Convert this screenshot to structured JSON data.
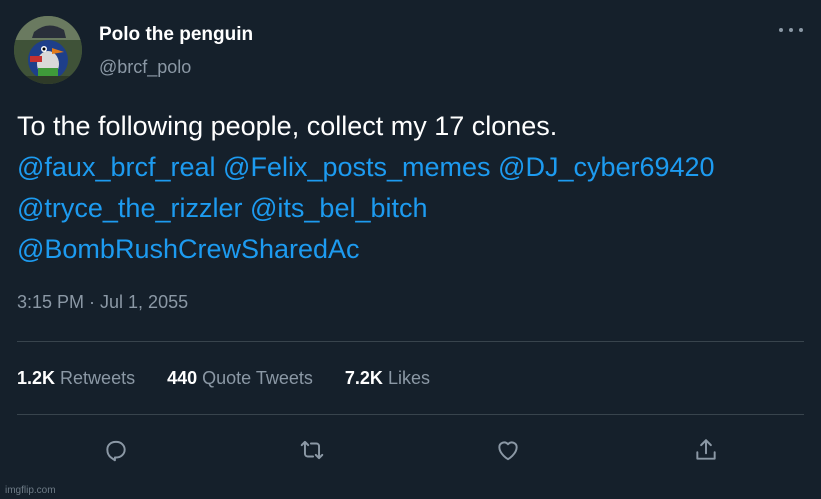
{
  "user": {
    "display_name": "Polo the penguin",
    "handle": "@brcf_polo",
    "avatar_icon": "penguin-avatar"
  },
  "tweet": {
    "text": "To the following people, collect my 17 clones.",
    "mentions": [
      "@faux_brcf_real",
      "@Felix_posts_memes",
      "@DJ_cyber69420",
      "@tryce_the_rizzler",
      "@its_bel_bitch",
      "@BombRushCrewSharedAc"
    ],
    "timestamp": "3:15 PM · Jul 1, 2055"
  },
  "stats": {
    "retweets": {
      "count": "1.2K",
      "label": "Retweets"
    },
    "quote_tweets": {
      "count": "440",
      "label": "Quote Tweets"
    },
    "likes": {
      "count": "7.2K",
      "label": "Likes"
    }
  },
  "actions": [
    {
      "icon": "reply-icon"
    },
    {
      "icon": "retweet-icon"
    },
    {
      "icon": "heart-icon"
    },
    {
      "icon": "share-icon"
    }
  ],
  "watermark": "imgflip.com",
  "colors": {
    "background": "#15202b",
    "mention": "#1d9bf0",
    "secondary_text": "#8b98a5",
    "divider": "#38444d"
  }
}
